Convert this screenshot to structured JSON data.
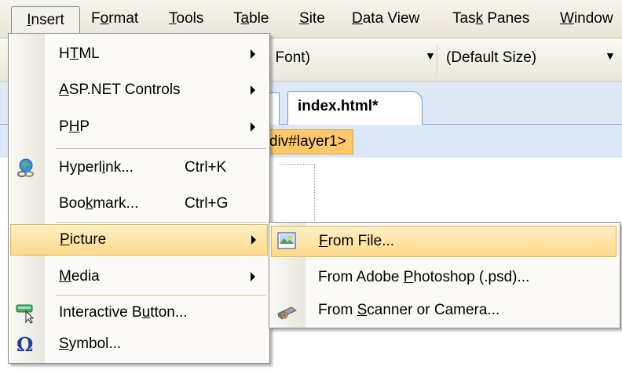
{
  "menubar": {
    "items": [
      {
        "pre": "",
        "key": "I",
        "post": "nsert"
      },
      {
        "pre": "F",
        "key": "o",
        "post": "rmat"
      },
      {
        "pre": "",
        "key": "T",
        "post": "ools"
      },
      {
        "pre": "T",
        "key": "a",
        "post": "ble"
      },
      {
        "pre": "",
        "key": "S",
        "post": "ite"
      },
      {
        "pre": "",
        "key": "D",
        "post": "ata View"
      },
      {
        "pre": "Tas",
        "key": "k",
        "post": " Panes"
      },
      {
        "pre": "",
        "key": "W",
        "post": "indow"
      }
    ]
  },
  "toolbar": {
    "font_value": ": Font)",
    "size_value": "(Default Size)"
  },
  "tabs": {
    "active_document": "index.html*"
  },
  "tagbar": {
    "crumb": "div#layer1>"
  },
  "insert_menu": {
    "items": [
      {
        "pre": "H",
        "key": "T",
        "post": "ML",
        "shortcut": "",
        "submenu": true
      },
      {
        "pre": "",
        "key": "A",
        "post": "SP.NET Controls",
        "shortcut": "",
        "submenu": true
      },
      {
        "pre": "P",
        "key": "H",
        "post": "P",
        "shortcut": "",
        "submenu": true
      },
      {
        "pre": "Hyperl",
        "key": "i",
        "post": "nk...",
        "shortcut": "Ctrl+K",
        "submenu": false,
        "icon": "hyperlink-globe-icon"
      },
      {
        "pre": "Boo",
        "key": "k",
        "post": "mark...",
        "shortcut": "Ctrl+G",
        "submenu": false
      },
      {
        "pre": "",
        "key": "P",
        "post": "icture",
        "shortcut": "",
        "submenu": true,
        "highlighted": true
      },
      {
        "pre": "",
        "key": "M",
        "post": "edia",
        "shortcut": "",
        "submenu": true
      },
      {
        "pre": "Interactive B",
        "key": "u",
        "post": "tton...",
        "shortcut": "",
        "submenu": false,
        "icon": "interactive-button-icon"
      },
      {
        "pre": "",
        "key": "S",
        "post": "ymbol...",
        "shortcut": "",
        "submenu": false,
        "icon": "omega-symbol-icon"
      }
    ]
  },
  "picture_submenu": {
    "items": [
      {
        "pre": "",
        "key": "F",
        "post": "rom File...",
        "highlighted": true,
        "icon": "picture-file-icon"
      },
      {
        "pre": "From Adobe ",
        "key": "P",
        "post": "hotoshop (.psd)...",
        "icon": ""
      },
      {
        "pre": "From ",
        "key": "S",
        "post": "canner or Camera...",
        "icon": "scanner-camera-icon"
      }
    ]
  },
  "colors": {
    "menu_highlight": "#ffd98a",
    "tag_crumb": "#ffc96b",
    "tab_strip": "#dfe7f4"
  }
}
